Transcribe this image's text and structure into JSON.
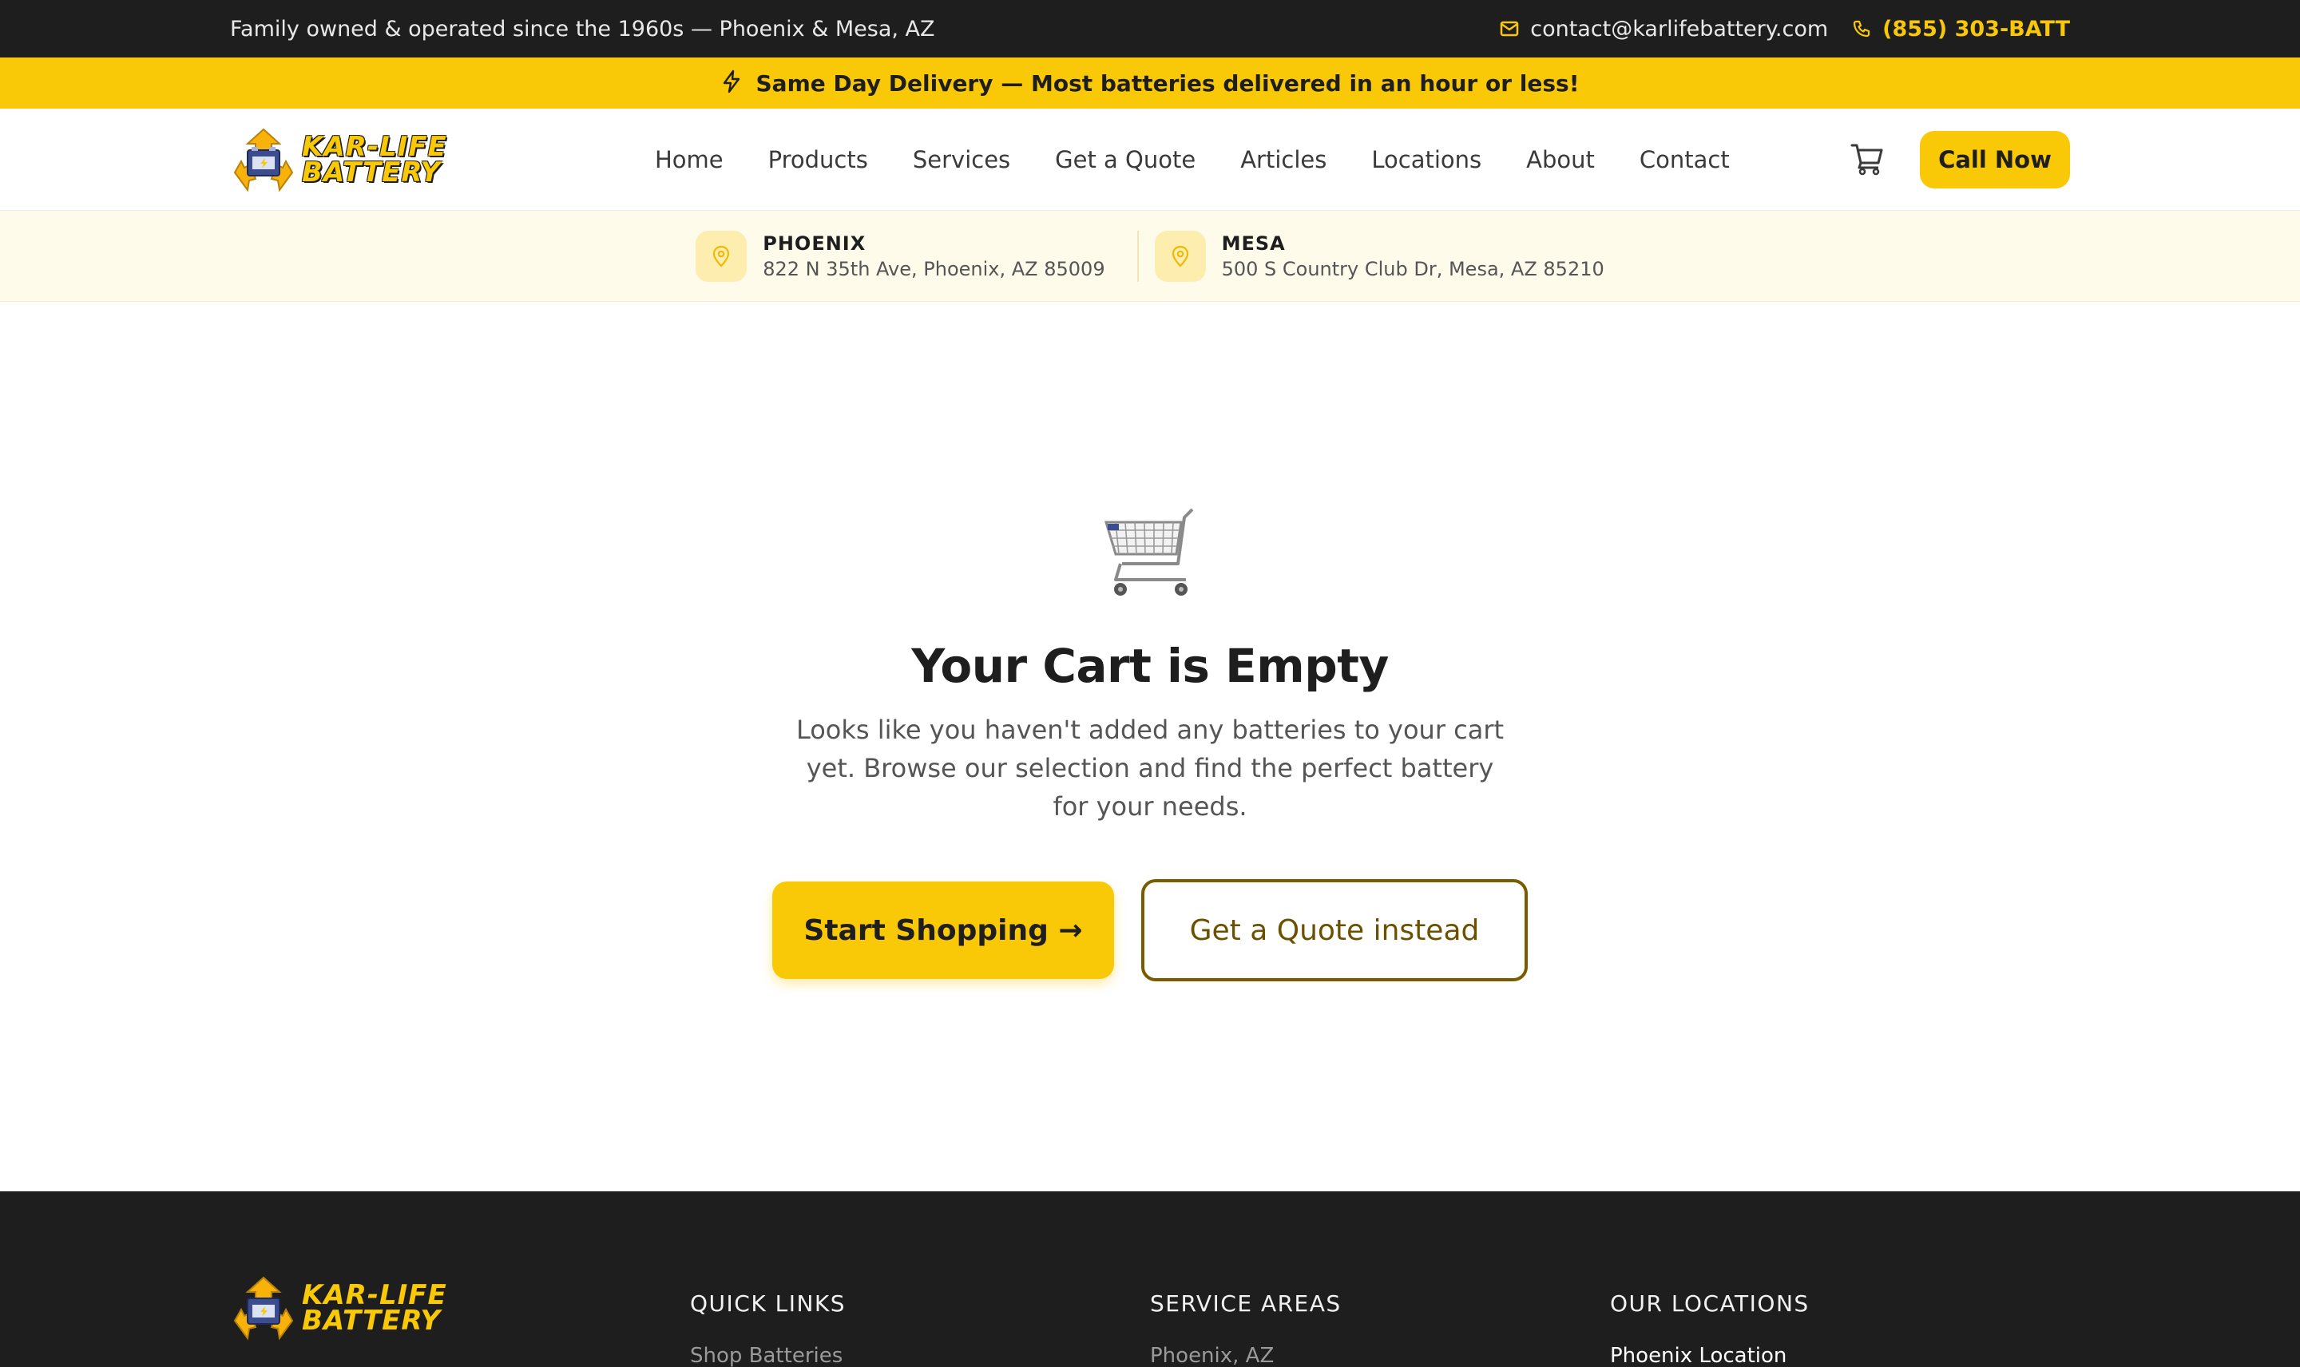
{
  "topbar": {
    "tagline": "Family owned & operated since the 1960s — Phoenix & Mesa, AZ",
    "email": "contact@karlifebattery.com",
    "phone": "(855) 303-BATT"
  },
  "promo": {
    "text": "Same Day Delivery — Most batteries delivered in an hour or less!"
  },
  "brand": {
    "line1": "KAR-LIFE",
    "line2": "BATTERY"
  },
  "nav": {
    "items": [
      "Home",
      "Products",
      "Services",
      "Get a Quote",
      "Articles",
      "Locations",
      "About",
      "Contact"
    ]
  },
  "header": {
    "call_label": "Call Now"
  },
  "locations": [
    {
      "name": "PHOENIX",
      "address": "822 N 35th Ave, Phoenix, AZ 85009"
    },
    {
      "name": "MESA",
      "address": "500 S Country Club Dr, Mesa, AZ 85210"
    }
  ],
  "empty_cart": {
    "title": "Your Cart is Empty",
    "message": "Looks like you haven't added any batteries to your cart yet. Browse our selection and find the perfect battery for your needs.",
    "primary_label": "Start Shopping →",
    "secondary_label": "Get a Quote instead"
  },
  "footer": {
    "quick_links_title": "QUICK LINKS",
    "quick_links_first": "Shop Batteries",
    "service_areas_title": "SERVICE AREAS",
    "service_areas_first": "Phoenix, AZ",
    "locations_title": "OUR LOCATIONS",
    "locations_first": "Phoenix Location"
  },
  "colors": {
    "accent": "#f9c806",
    "dark": "#1e1e1e",
    "outline_brown": "#7a5b00"
  },
  "icons": {
    "email": "mail-icon",
    "phone": "phone-icon",
    "promo": "lightning-icon",
    "cart": "cart-icon",
    "pin": "map-pin-icon",
    "empty": "shopping-cart-illustration"
  }
}
